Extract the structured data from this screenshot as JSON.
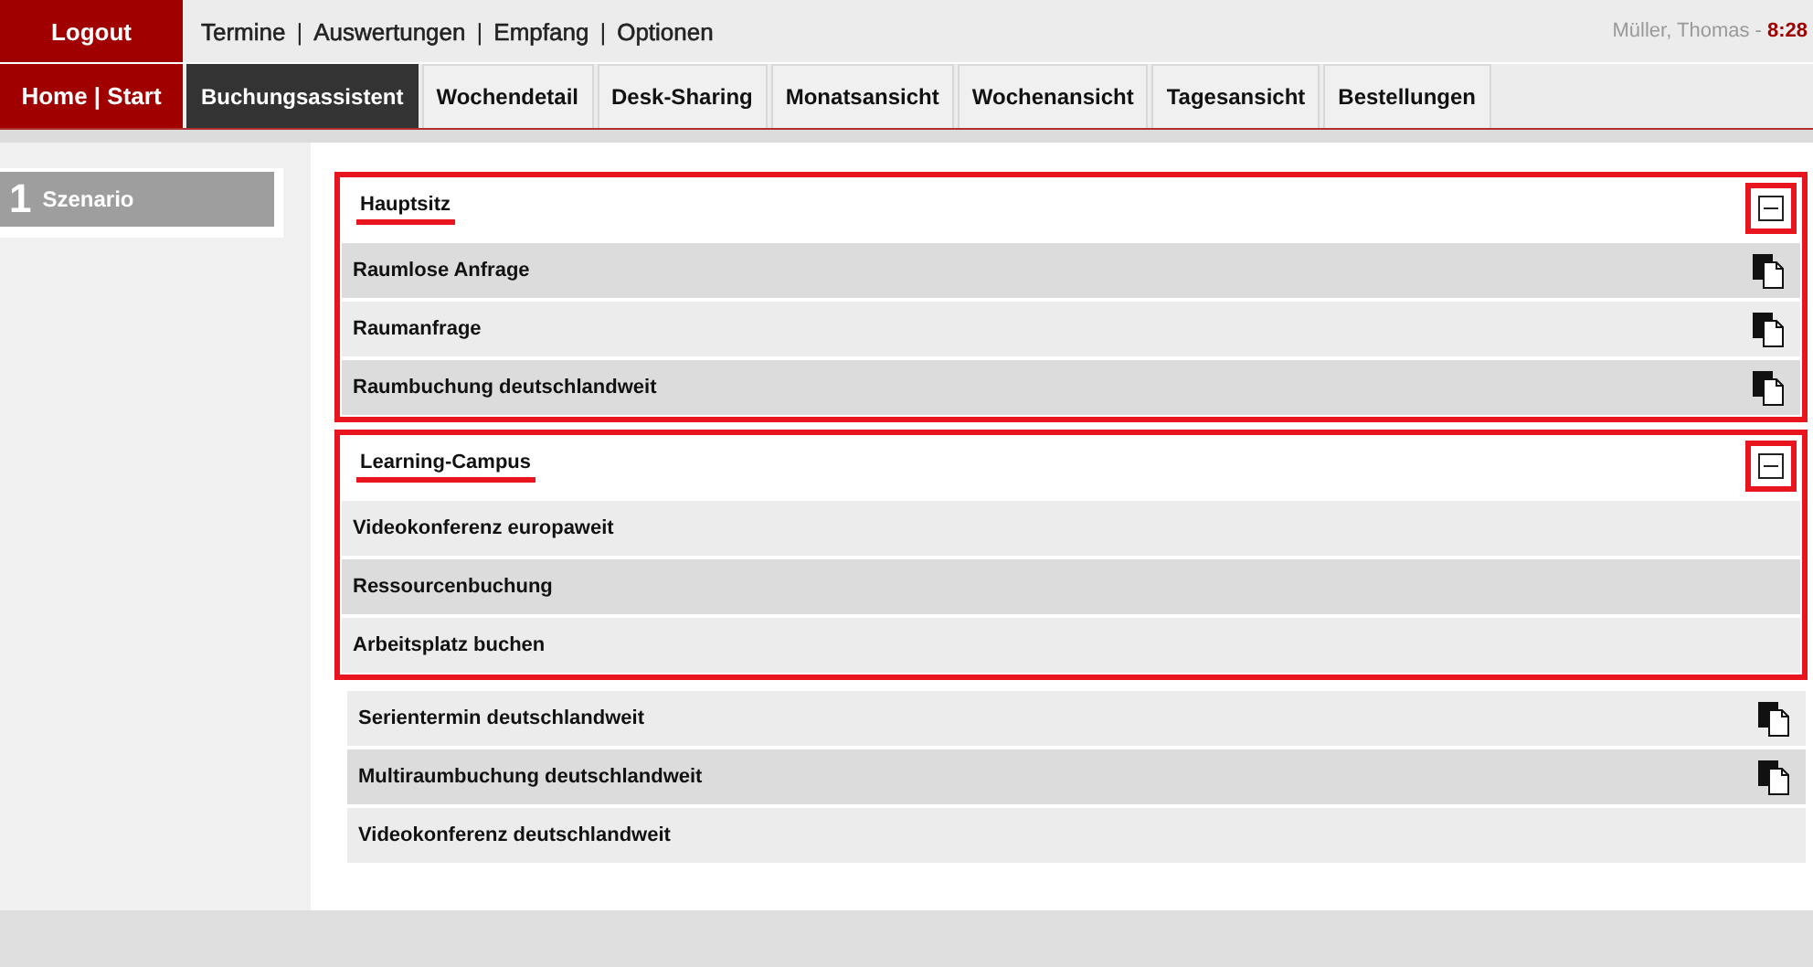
{
  "top_bar": {
    "logout": "Logout",
    "links": [
      "Termine",
      "Auswertungen",
      "Empfang",
      "Optionen"
    ],
    "separator": "|",
    "user": "Müller, Thomas -",
    "time": "8:28"
  },
  "nav": {
    "home": "Home | Start",
    "tabs": [
      {
        "label": "Buchungsassistent",
        "selected": true
      },
      {
        "label": "Wochendetail",
        "selected": false
      },
      {
        "label": "Desk-Sharing",
        "selected": false
      },
      {
        "label": "Monatsansicht",
        "selected": false
      },
      {
        "label": "Wochenansicht",
        "selected": false
      },
      {
        "label": "Tagesansicht",
        "selected": false
      },
      {
        "label": "Bestellungen",
        "selected": false
      }
    ]
  },
  "sidebar": {
    "step": "1",
    "label": "Szenario"
  },
  "groups": [
    {
      "title": "Hauptsitz",
      "expanded": true,
      "highlighted": true,
      "items": [
        {
          "label": "Raumlose Anfrage",
          "shaded": true,
          "copy_icon": true
        },
        {
          "label": "Raumanfrage",
          "shaded": false,
          "copy_icon": true
        },
        {
          "label": "Raumbuchung deutschlandweit",
          "shaded": true,
          "copy_icon": true
        }
      ]
    },
    {
      "title": "Learning-Campus",
      "expanded": true,
      "highlighted": true,
      "items": [
        {
          "label": "Videokonferenz europaweit",
          "shaded": false,
          "copy_icon": false
        },
        {
          "label": "Ressourcenbuchung",
          "shaded": true,
          "copy_icon": false
        },
        {
          "label": "Arbeitsplatz buchen",
          "shaded": false,
          "copy_icon": false
        }
      ]
    }
  ],
  "items": [
    {
      "label": "Serientermin deutschlandweit",
      "shaded": false,
      "copy_icon": true
    },
    {
      "label": "Multiraumbuchung deutschlandweit",
      "shaded": true,
      "copy_icon": true
    },
    {
      "label": "Videokonferenz deutschlandweit",
      "shaded": false,
      "copy_icon": false
    }
  ]
}
